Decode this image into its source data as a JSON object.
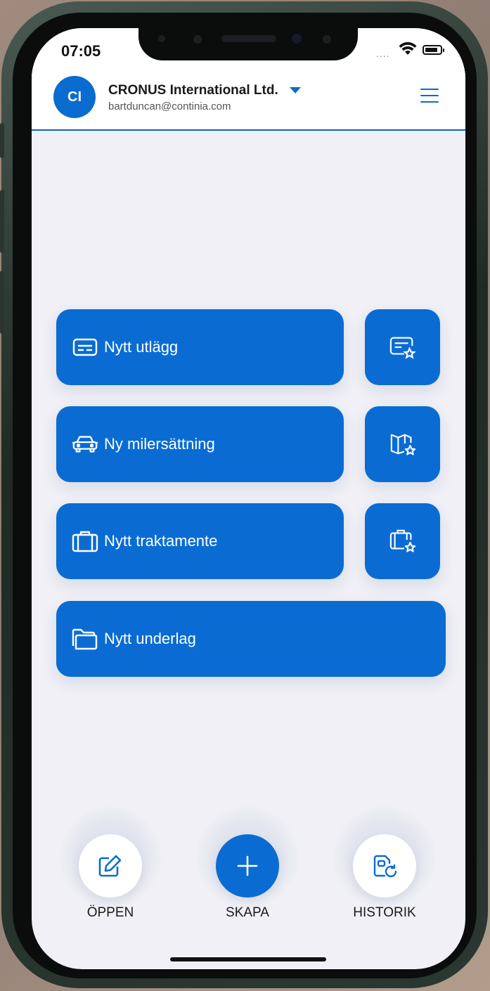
{
  "status_bar": {
    "time": "07:05",
    "signal": "....",
    "wifi_icon": "wifi-icon",
    "battery_icon": "battery-icon",
    "battery_level": 0.85
  },
  "header": {
    "avatar_initials": "CI",
    "company": "CRONUS International Ltd.",
    "email": "bartduncan@continia.com",
    "dropdown_icon": "caret-down-icon",
    "menu_icon": "hamburger-menu-icon"
  },
  "actions": {
    "new_expense": "Nytt utlägg",
    "new_mileage": "Ny milersättning",
    "new_allowance": "Nytt traktamente",
    "new_attachment": "Nytt underlag",
    "favorites_icons": [
      "card-star-icon",
      "map-star-icon",
      "suitcase-star-icon"
    ]
  },
  "bottom_nav": {
    "open": "ÖPPEN",
    "create": "SKAPA",
    "history": "HISTORIK"
  },
  "colors": {
    "accent": "#0a6cd3",
    "background": "#f0f0f6",
    "text": "#1a1a1a"
  }
}
